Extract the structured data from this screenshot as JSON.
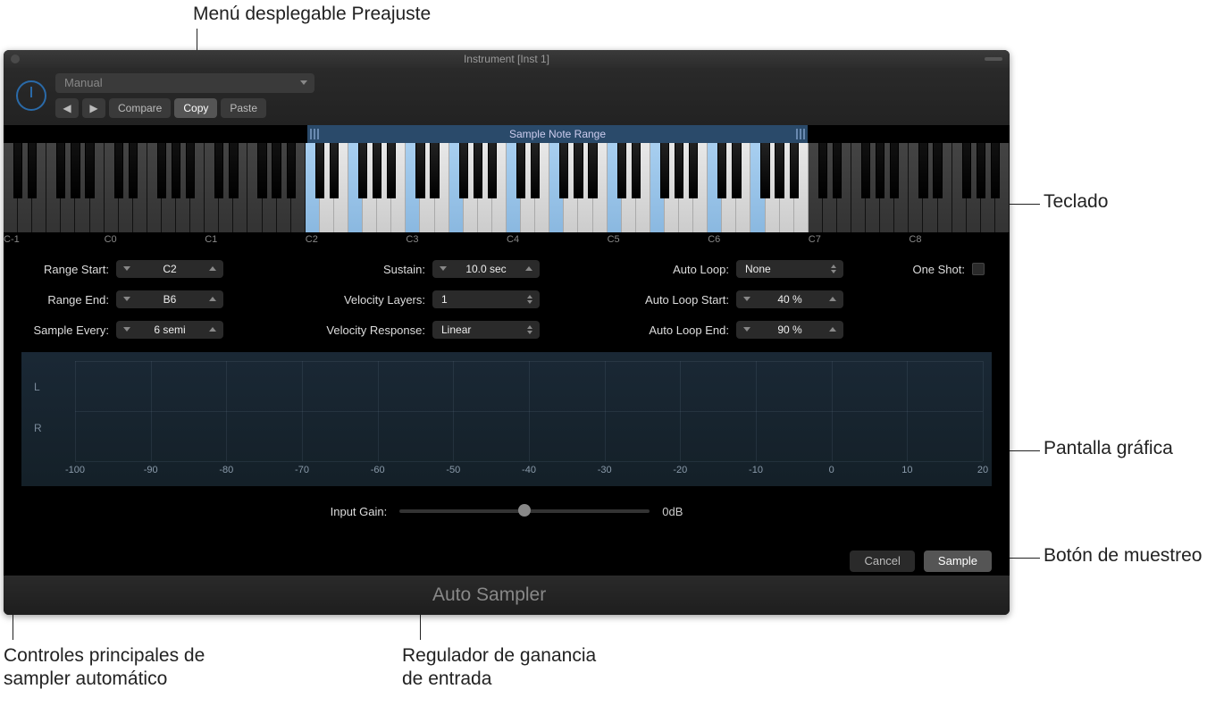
{
  "callouts": {
    "preset_menu": "Menú desplegable Preajuste",
    "keyboard": "Teclado",
    "graphic_display": "Pantalla gráfica",
    "sample_button": "Botón de muestreo",
    "main_controls_l1": "Controles principales de",
    "main_controls_l2": "sampler automático",
    "gain_reg_l1": "Regulador de ganancia",
    "gain_reg_l2": "de entrada"
  },
  "window": {
    "title": "Instrument [Inst 1]",
    "preset": "Manual",
    "toolbar": {
      "compare": "Compare",
      "copy": "Copy",
      "paste": "Paste"
    }
  },
  "keyboard": {
    "range_label": "Sample Note Range",
    "octaves": [
      "C-1",
      "C0",
      "C1",
      "C2",
      "C3",
      "C4",
      "C5",
      "C6",
      "C7",
      "C8"
    ]
  },
  "params": {
    "range_start": {
      "label": "Range Start:",
      "value": "C2"
    },
    "range_end": {
      "label": "Range End:",
      "value": "B6"
    },
    "sample_every": {
      "label": "Sample Every:",
      "value": "6 semi"
    },
    "sustain": {
      "label": "Sustain:",
      "value": "10.0 sec"
    },
    "vel_layers": {
      "label": "Velocity Layers:",
      "value": "1"
    },
    "vel_response": {
      "label": "Velocity Response:",
      "value": "Linear"
    },
    "auto_loop": {
      "label": "Auto Loop:",
      "value": "None"
    },
    "auto_loop_start": {
      "label": "Auto Loop Start:",
      "value": "40 %"
    },
    "auto_loop_end": {
      "label": "Auto Loop End:",
      "value": "90 %"
    },
    "one_shot": {
      "label": "One Shot:"
    }
  },
  "graph": {
    "channels": {
      "left": "L",
      "right": "R"
    },
    "ticks": [
      "-100",
      "-90",
      "-80",
      "-70",
      "-60",
      "-50",
      "-40",
      "-30",
      "-20",
      "-10",
      "0",
      "10",
      "20"
    ]
  },
  "gain": {
    "label": "Input Gain:",
    "value": "0dB"
  },
  "buttons": {
    "cancel": "Cancel",
    "sample": "Sample"
  },
  "footer": "Auto Sampler"
}
